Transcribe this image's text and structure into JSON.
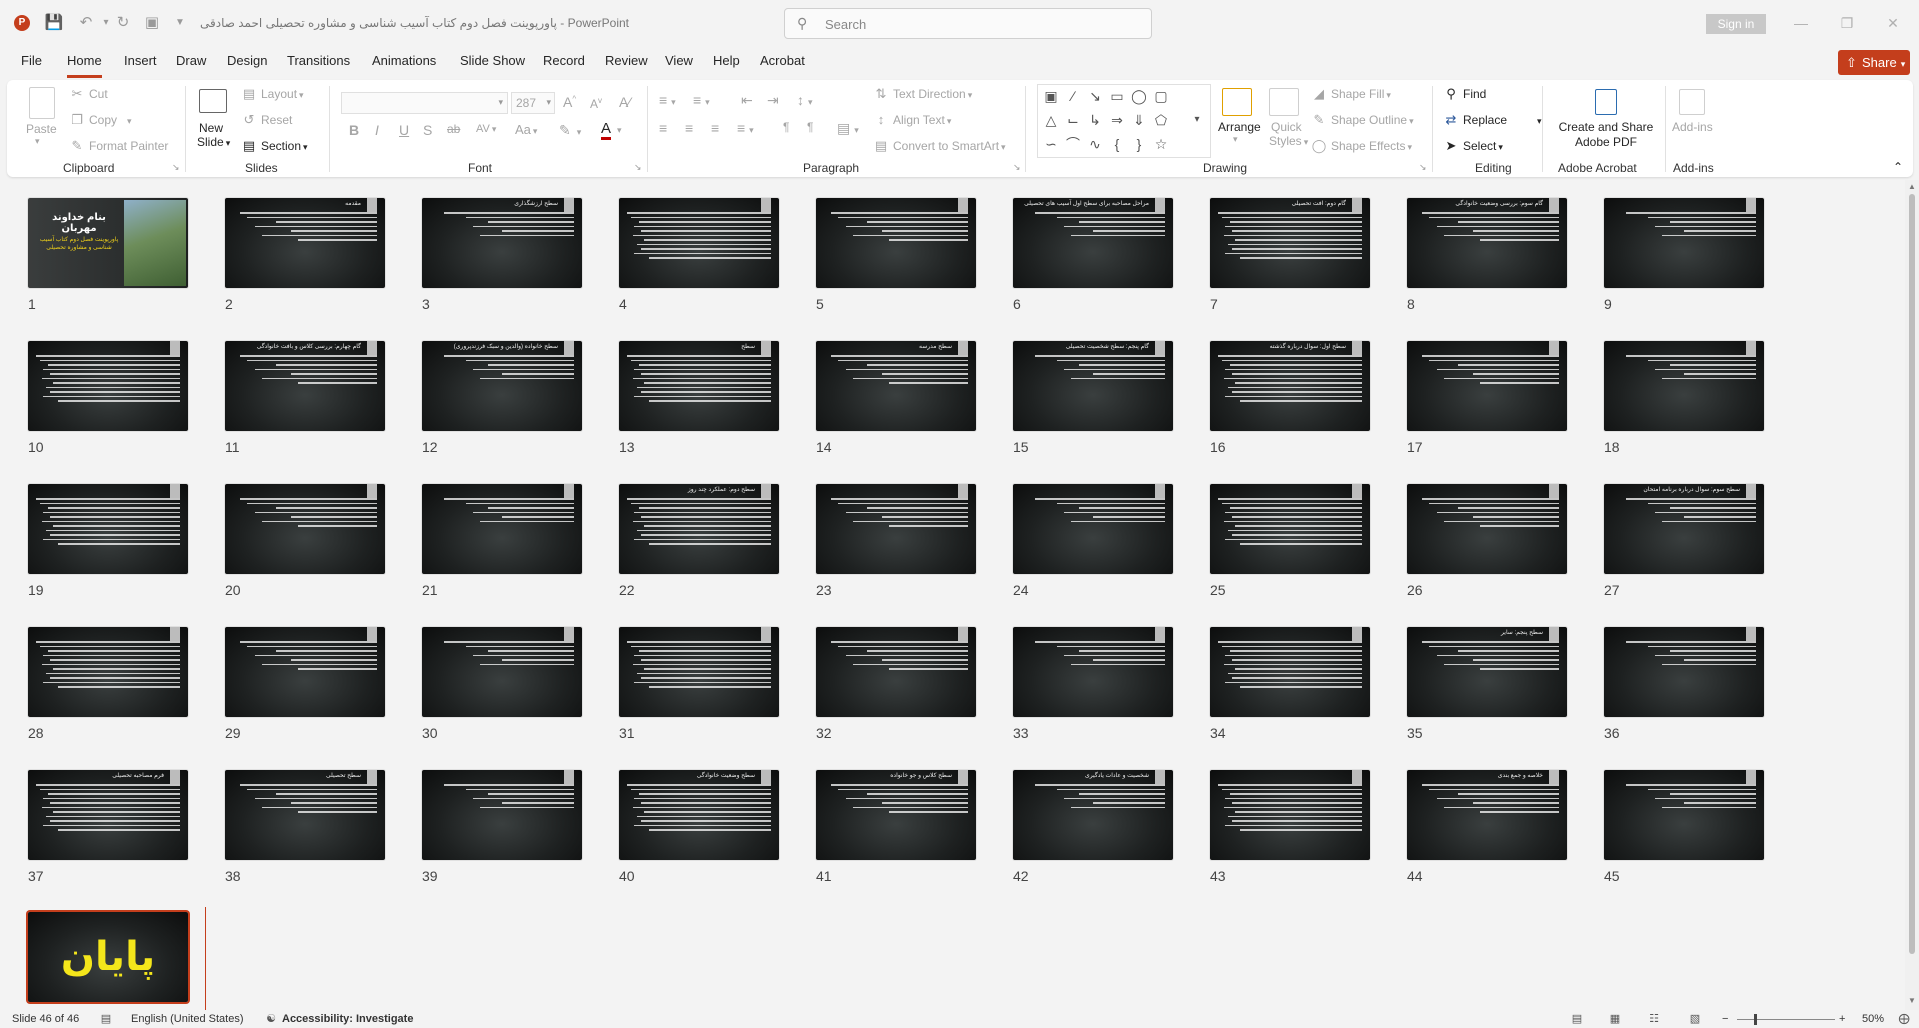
{
  "app": {
    "logo_letter": "P",
    "title_app": "PowerPoint",
    "document_title": "پاورپوینت فصل دوم کتاب آسیب شناسی و مشاوره تحصیلی احمد صادقی",
    "title_separator": "-",
    "search_placeholder": "Search",
    "sign_in": "Sign in"
  },
  "menu": {
    "tabs": [
      "File",
      "Home",
      "Insert",
      "Draw",
      "Design",
      "Transitions",
      "Animations",
      "Slide Show",
      "Record",
      "Review",
      "View",
      "Help",
      "Acrobat"
    ],
    "active_tab": "Home",
    "share_label": "Share"
  },
  "ribbon": {
    "clipboard": {
      "paste": "Paste",
      "cut": "Cut",
      "copy": "Copy",
      "format_painter": "Format Painter",
      "label": "Clipboard"
    },
    "slides": {
      "new_slide_1": "New",
      "new_slide_2": "Slide",
      "layout": "Layout",
      "reset": "Reset",
      "section": "Section",
      "label": "Slides"
    },
    "font": {
      "font_size": "287",
      "label": "Font",
      "bold": "B",
      "italic": "I",
      "underline": "U",
      "shadow": "S",
      "strike": "ab",
      "spacing": "AV",
      "case": "Aa",
      "grow": "A",
      "shrink": "A"
    },
    "paragraph": {
      "text_direction": "Text Direction",
      "align_text": "Align Text",
      "convert_smartart": "Convert to SmartArt",
      "label": "Paragraph"
    },
    "drawing": {
      "arrange": "Arrange",
      "quick_styles_1": "Quick",
      "quick_styles_2": "Styles",
      "shape_fill": "Shape Fill",
      "shape_outline": "Shape Outline",
      "shape_effects": "Shape Effects",
      "label": "Drawing"
    },
    "editing": {
      "find": "Find",
      "replace": "Replace",
      "select": "Select",
      "label": "Editing"
    },
    "acrobat": {
      "create_1": "Create and Share",
      "create_2": "Adobe PDF",
      "label": "Adobe Acrobat"
    },
    "addins": {
      "addins_btn": "Add-ins",
      "label": "Add-ins"
    }
  },
  "slides": [
    {
      "n": "1",
      "title": "بنام خداوند مهربان"
    },
    {
      "n": "2",
      "title": "مقدمه"
    },
    {
      "n": "3",
      "title": "سطح ارزشگذاری"
    },
    {
      "n": "4",
      "title": ""
    },
    {
      "n": "5",
      "title": ""
    },
    {
      "n": "6",
      "title": "مراحل مصاحبه برای سطح اول آسیب های تحصیلی"
    },
    {
      "n": "7",
      "title": "گام دوم: افت تحصیلی"
    },
    {
      "n": "8",
      "title": "گام سوم: بررسی وضعیت خانوادگی"
    },
    {
      "n": "9",
      "title": ""
    },
    {
      "n": "10",
      "title": ""
    },
    {
      "n": "11",
      "title": "گام چهارم: بررسی کلاس و بافت خانوادگی"
    },
    {
      "n": "12",
      "title": "سطح خانواده (والدین و سبک فرزندپروری)"
    },
    {
      "n": "13",
      "title": "سطح"
    },
    {
      "n": "14",
      "title": "سطح مدرسه"
    },
    {
      "n": "15",
      "title": "گام پنجم: سطح شخصیت تحصیلی"
    },
    {
      "n": "16",
      "title": "سطح اول: سوال درباره گذشته"
    },
    {
      "n": "17",
      "title": ""
    },
    {
      "n": "18",
      "title": ""
    },
    {
      "n": "19",
      "title": ""
    },
    {
      "n": "20",
      "title": ""
    },
    {
      "n": "21",
      "title": ""
    },
    {
      "n": "22",
      "title": "سطح دوم: عملکرد چند روز"
    },
    {
      "n": "23",
      "title": ""
    },
    {
      "n": "24",
      "title": ""
    },
    {
      "n": "25",
      "title": ""
    },
    {
      "n": "26",
      "title": ""
    },
    {
      "n": "27",
      "title": "سطح سوم: سوال درباره برنامه امتحان"
    },
    {
      "n": "28",
      "title": ""
    },
    {
      "n": "29",
      "title": ""
    },
    {
      "n": "30",
      "title": ""
    },
    {
      "n": "31",
      "title": ""
    },
    {
      "n": "32",
      "title": ""
    },
    {
      "n": "33",
      "title": ""
    },
    {
      "n": "34",
      "title": ""
    },
    {
      "n": "35",
      "title": "سطح پنجم: سایر"
    },
    {
      "n": "36",
      "title": ""
    },
    {
      "n": "37",
      "title": "فرم مصاحبه تحصیلی"
    },
    {
      "n": "38",
      "title": "سطح تحصیلی"
    },
    {
      "n": "39",
      "title": ""
    },
    {
      "n": "40",
      "title": "سطح وضعیت خانوادگی"
    },
    {
      "n": "41",
      "title": "سطح کلاس و جو خانواده"
    },
    {
      "n": "42",
      "title": "شخصیت و عادات یادگیری"
    },
    {
      "n": "43",
      "title": ""
    },
    {
      "n": "44",
      "title": "خلاصه و جمع بندی"
    },
    {
      "n": "45",
      "title": ""
    },
    {
      "n": "46",
      "title": "پایان"
    }
  ],
  "title_slide": {
    "title": "بنام خداوند مهربان",
    "subtitle": "پاورپوینت فصل دوم کتاب آسیب شناسی و مشاوره تحصیلی"
  },
  "end_slide": {
    "title": "پایان"
  },
  "status": {
    "slide_counter": "Slide 46 of 46",
    "language": "English (United States)",
    "accessibility": "Accessibility: Investigate",
    "zoom": "50%",
    "zoom_minus": "−",
    "zoom_plus": "+"
  },
  "colors": {
    "accent": "#c43e1c",
    "end_title": "#f4e61b"
  }
}
